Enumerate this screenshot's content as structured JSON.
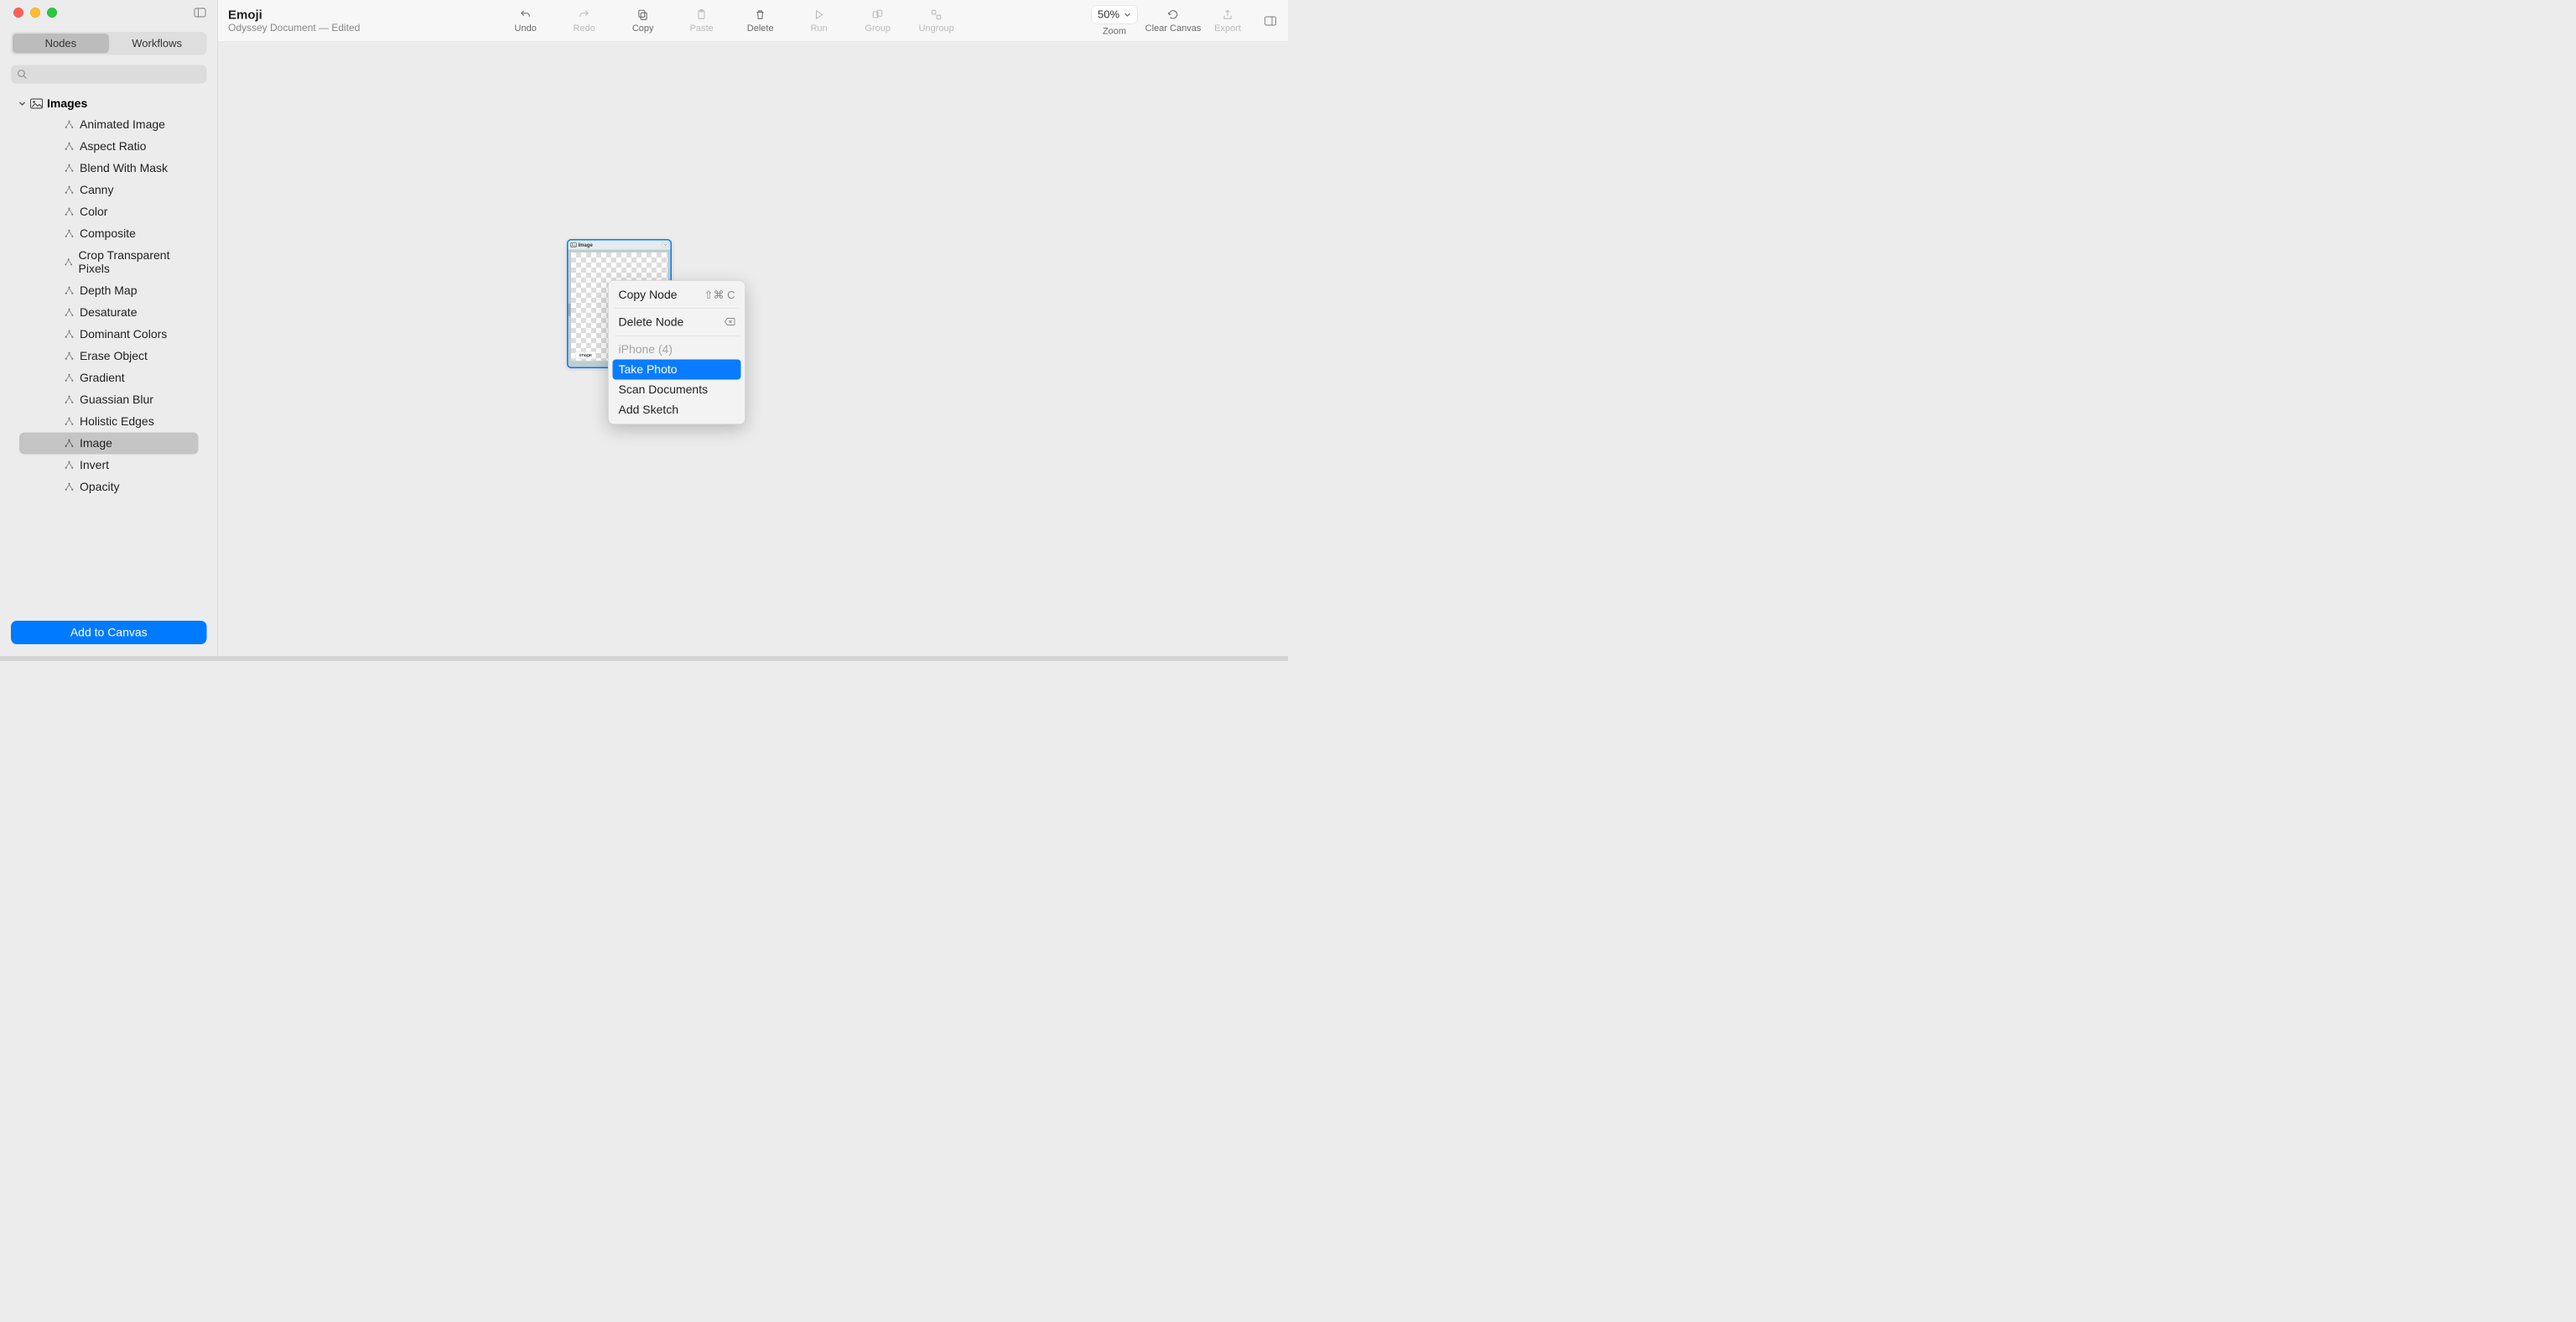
{
  "window": {
    "doc_title": "Emoji",
    "doc_subtitle": "Odyssey Document — Edited"
  },
  "tabs": {
    "nodes": "Nodes",
    "workflows": "Workflows",
    "selected": "nodes"
  },
  "search": {
    "placeholder": ""
  },
  "tree": {
    "header": "Images",
    "items": [
      "Animated Image",
      "Aspect Ratio",
      "Blend With Mask",
      "Canny",
      "Color",
      "Composite",
      "Crop Transparent Pixels",
      "Depth Map",
      "Desaturate",
      "Dominant Colors",
      "Erase Object",
      "Gradient",
      "Guassian Blur",
      "Holistic Edges",
      "Image",
      "Invert",
      "Opacity"
    ],
    "selected_index": 14
  },
  "add_button": "Add to Canvas",
  "toolbar": {
    "undo": "Undo",
    "redo": "Redo",
    "copy": "Copy",
    "paste": "Paste",
    "delete": "Delete",
    "run": "Run",
    "group": "Group",
    "ungroup": "Ungroup",
    "zoom_value": "50%",
    "zoom": "Zoom",
    "clear_canvas": "Clear Canvas",
    "export": "Export"
  },
  "node": {
    "title": "Image",
    "footer": "image"
  },
  "context_menu": {
    "copy_node": "Copy Node",
    "copy_shortcut": "⇧⌘ C",
    "delete_node": "Delete Node",
    "device_label": "iPhone (4)",
    "take_photo": "Take Photo",
    "scan_documents": "Scan Documents",
    "add_sketch": "Add Sketch"
  }
}
